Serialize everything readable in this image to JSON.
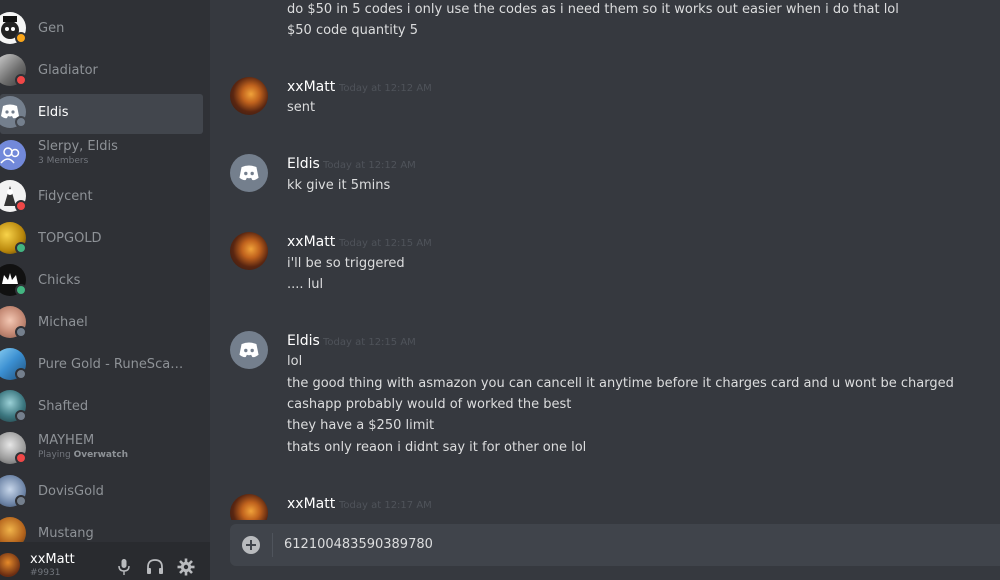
{
  "sidebar": {
    "dms": [
      {
        "name": "Gen",
        "status": "idle",
        "status_color": "#faa61a",
        "avatar": "gen"
      },
      {
        "name": "Gladiator",
        "status": "dnd",
        "status_color": "#f04747",
        "avatar": "gladiator"
      },
      {
        "name": "Eldis",
        "status": "offline",
        "status_color": "#747f8d",
        "avatar": "discord",
        "active": true
      },
      {
        "name": "Slerpy, Eldis",
        "sub": "3 Members",
        "avatar": "group"
      },
      {
        "name": "Fidycent",
        "status": "dnd",
        "status_color": "#f04747",
        "avatar": "fidycent"
      },
      {
        "name": "TOPGOLD",
        "status": "online",
        "status_color": "#43b581",
        "avatar": "topgold"
      },
      {
        "name": "Chicks",
        "status": "online",
        "status_color": "#43b581",
        "avatar": "chicks"
      },
      {
        "name": "Michael",
        "status": "offline",
        "status_color": "#747f8d",
        "avatar": "michael"
      },
      {
        "name": "Pure Gold - RuneScape ...",
        "status": "offline",
        "status_color": "#747f8d",
        "avatar": "puregold"
      },
      {
        "name": "Shafted",
        "status": "offline",
        "status_color": "#747f8d",
        "avatar": "shafted"
      },
      {
        "name": "MAYHEM",
        "sub_prefix": "Playing",
        "sub_game": "Overwatch",
        "status": "dnd",
        "status_color": "#f04747",
        "avatar": "mayhem"
      },
      {
        "name": "DovisGold",
        "status": "offline",
        "status_color": "#747f8d",
        "avatar": "dovis"
      },
      {
        "name": "Mustang",
        "avatar": "mustang"
      }
    ]
  },
  "user": {
    "name": "xxMatt",
    "tag": "#9931"
  },
  "messages": {
    "top_line1": "do $50 in 5 codes i only use the codes as i need them so it works out easier when i do that lol",
    "top_line2": "$50 code quantity 5",
    "groups": [
      {
        "author": "xxMatt",
        "time": "Today at 12:12 AM",
        "lines": [
          "sent"
        ]
      },
      {
        "author": "Eldis",
        "time": "Today at 12:12 AM",
        "lines": [
          "kk give it 5mins"
        ]
      },
      {
        "author": "xxMatt",
        "time": "Today at 12:15 AM",
        "lines": [
          "i'll be so triggered",
          ".... lul"
        ]
      },
      {
        "author": "Eldis",
        "time": "Today at 12:15 AM",
        "lines": [
          "lol",
          "the good thing with asmazon you can cancell it anytime before it charges card and u wont be charged",
          "cashapp probably would of worked the best",
          "they have a $250 limit",
          "thats only reaon i didnt say it for other one lol"
        ]
      },
      {
        "author": "xxMatt",
        "time": "Today at 12:17 AM",
        "lines": []
      }
    ]
  },
  "input": {
    "value": "612100483590389780"
  }
}
